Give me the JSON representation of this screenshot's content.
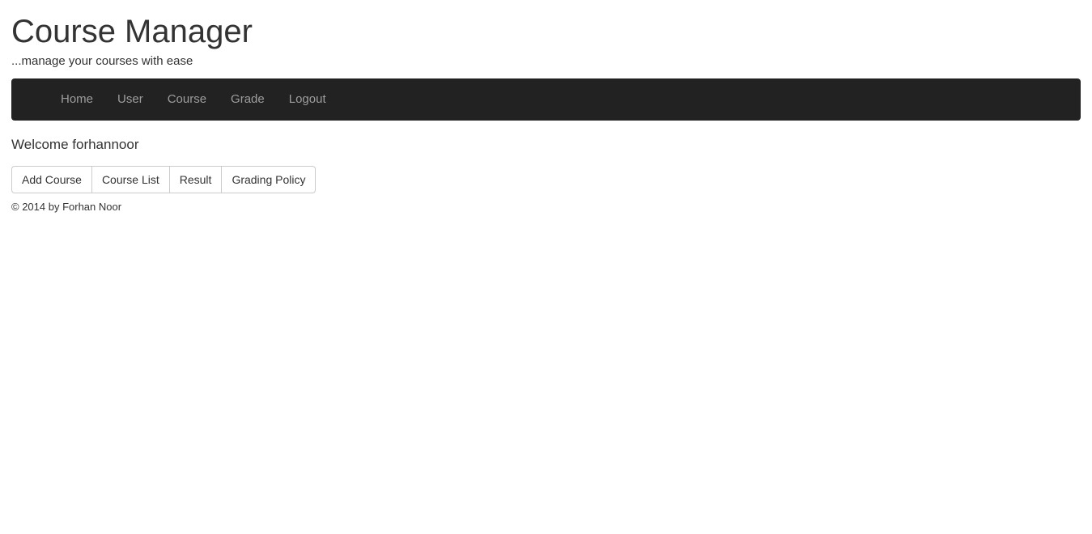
{
  "header": {
    "title": "Course Manager",
    "tagline": "...manage your courses with ease"
  },
  "navbar": {
    "background_color": "#222222",
    "link_color": "#9d9d9d",
    "items": [
      {
        "label": "Home",
        "name": "nav-link-home"
      },
      {
        "label": "User",
        "name": "nav-link-user"
      },
      {
        "label": "Course",
        "name": "nav-link-course"
      },
      {
        "label": "Grade",
        "name": "nav-link-grade"
      },
      {
        "label": "Logout",
        "name": "nav-link-logout"
      }
    ]
  },
  "main": {
    "welcome_text": "Welcome forhannoor",
    "actions": [
      {
        "label": "Add Course"
      },
      {
        "label": "Course List"
      },
      {
        "label": "Result"
      },
      {
        "label": "Grading Policy"
      }
    ]
  },
  "footer": {
    "copyright": "© 2014 by Forhan Noor"
  }
}
